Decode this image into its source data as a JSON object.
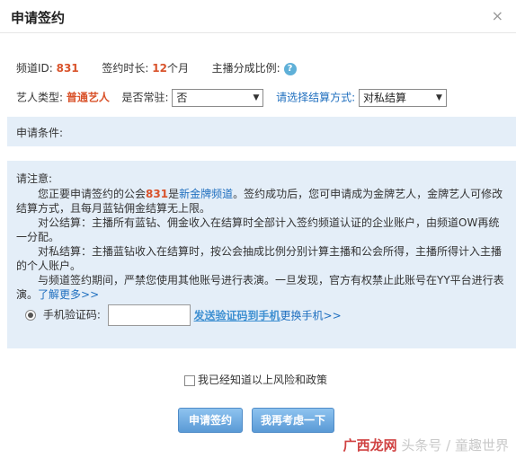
{
  "dialog": {
    "title": "申请签约",
    "close": "×"
  },
  "info": {
    "channel_label": "频道ID:",
    "channel_value": "831",
    "duration_label": "签约时长:",
    "duration_value": "12",
    "duration_unit": "个月",
    "share_label": "主播分成比例:",
    "help": "?"
  },
  "artist": {
    "type_label": "艺人类型:",
    "type_value": "普通艺人",
    "resident_label": "是否常驻:",
    "resident_value": "否",
    "settlement_label": "请选择结算方式:",
    "settlement_value": "对私结算"
  },
  "conditions": {
    "label": "申请条件:"
  },
  "notice": {
    "title": "请注意:",
    "p1_a": "您正要申请签约的公会",
    "p1_id": "831",
    "p1_b": "是",
    "p1_link": "新金牌频道",
    "p1_c": "。签约成功后，您可申请成为金牌艺人，金牌艺人可修改结算方式，且每月蓝钻佣金结算无上限。",
    "p2": "对公结算：主播所有蓝钻、佣金收入在结算时全部计入签约频道认证的企业账户，由频道OW再统一分配。",
    "p3": "对私结算：主播蓝钻收入在结算时，按公会抽成比例分别计算主播和公会所得，主播所得计入主播的个人账户。",
    "p4": "与频道签约期间，严禁您使用其他账号进行表演。一旦发现，官方有权禁止此账号在YY平台进行表演。",
    "more": "了解更多>>"
  },
  "verify": {
    "label": "手机验证码:",
    "send": "发送验证码到手机",
    "change": "更换手机>>"
  },
  "agree": {
    "label": "我已经知道以上风险和政策"
  },
  "buttons": {
    "apply": "申请签约",
    "later": "我再考虑一下"
  },
  "watermark": {
    "text": "头条号 / 童趣世界",
    "brand": "广西龙网"
  }
}
